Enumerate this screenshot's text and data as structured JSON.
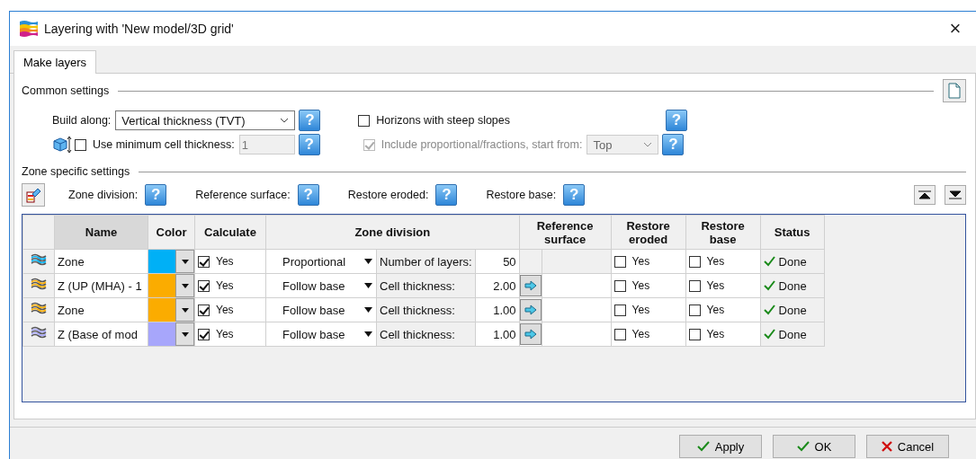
{
  "window": {
    "title": "Layering with 'New model/3D grid'",
    "close": "×"
  },
  "tabs": [
    {
      "label": "Make layers",
      "selected": true
    }
  ],
  "common": {
    "title": "Common settings",
    "build_along_label": "Build along:",
    "build_along_value": "Vertical thickness (TVT)",
    "build_along_help": "?",
    "min_cell": {
      "label": "Use minimum cell thickness:",
      "checked": false,
      "value": "1",
      "help": "?"
    },
    "steep": {
      "label": "Horizons with steep slopes",
      "checked": false,
      "help": "?"
    },
    "include": {
      "label": "Include proportional/fractions, start from:",
      "checked": true,
      "disabled": true,
      "value": "Top",
      "help": "?"
    }
  },
  "zone": {
    "title": "Zone specific settings",
    "help_labels": [
      {
        "label": "Zone division:",
        "help": "?"
      },
      {
        "label": "Reference surface:",
        "help": "?"
      },
      {
        "label": "Restore eroded:",
        "help": "?"
      },
      {
        "label": "Restore base:",
        "help": "?"
      }
    ]
  },
  "table": {
    "columns": [
      "Name",
      "Color",
      "Calculate",
      "Zone division",
      "Reference surface",
      "Restore eroded",
      "Restore base",
      "Status"
    ],
    "rows": [
      {
        "name": "Zone",
        "color": "#00b0f6",
        "calculate": true,
        "calculate_label": "Yes",
        "division": "Proportional",
        "param_label": "Number of layers:",
        "param_value": "50",
        "ref_button": false,
        "restore_eroded": false,
        "restore_eroded_label": "Yes",
        "restore_base": false,
        "restore_base_label": "Yes",
        "status": "Done"
      },
      {
        "name": "Z (UP (MHA) - 1",
        "color": "#fbac00",
        "calculate": true,
        "calculate_label": "Yes",
        "division": "Follow base",
        "param_label": "Cell thickness:",
        "param_value": "2.00",
        "ref_button": true,
        "restore_eroded": false,
        "restore_eroded_label": "Yes",
        "restore_base": false,
        "restore_base_label": "Yes",
        "status": "Done"
      },
      {
        "name": "Zone",
        "color": "#fbac00",
        "calculate": true,
        "calculate_label": "Yes",
        "division": "Follow base",
        "param_label": "Cell thickness:",
        "param_value": "1.00",
        "ref_button": true,
        "restore_eroded": false,
        "restore_eroded_label": "Yes",
        "restore_base": false,
        "restore_base_label": "Yes",
        "status": "Done"
      },
      {
        "name": "Z (Base of mod",
        "color": "#a7a6fb",
        "calculate": true,
        "calculate_label": "Yes",
        "division": "Follow base",
        "param_label": "Cell thickness:",
        "param_value": "1.00",
        "ref_button": true,
        "restore_eroded": false,
        "restore_eroded_label": "Yes",
        "restore_base": false,
        "restore_base_label": "Yes",
        "status": "Done"
      }
    ]
  },
  "buttons": [
    {
      "label": "Apply",
      "kind": "ok"
    },
    {
      "label": "OK",
      "kind": "ok"
    },
    {
      "label": "Cancel",
      "kind": "cancel"
    }
  ]
}
